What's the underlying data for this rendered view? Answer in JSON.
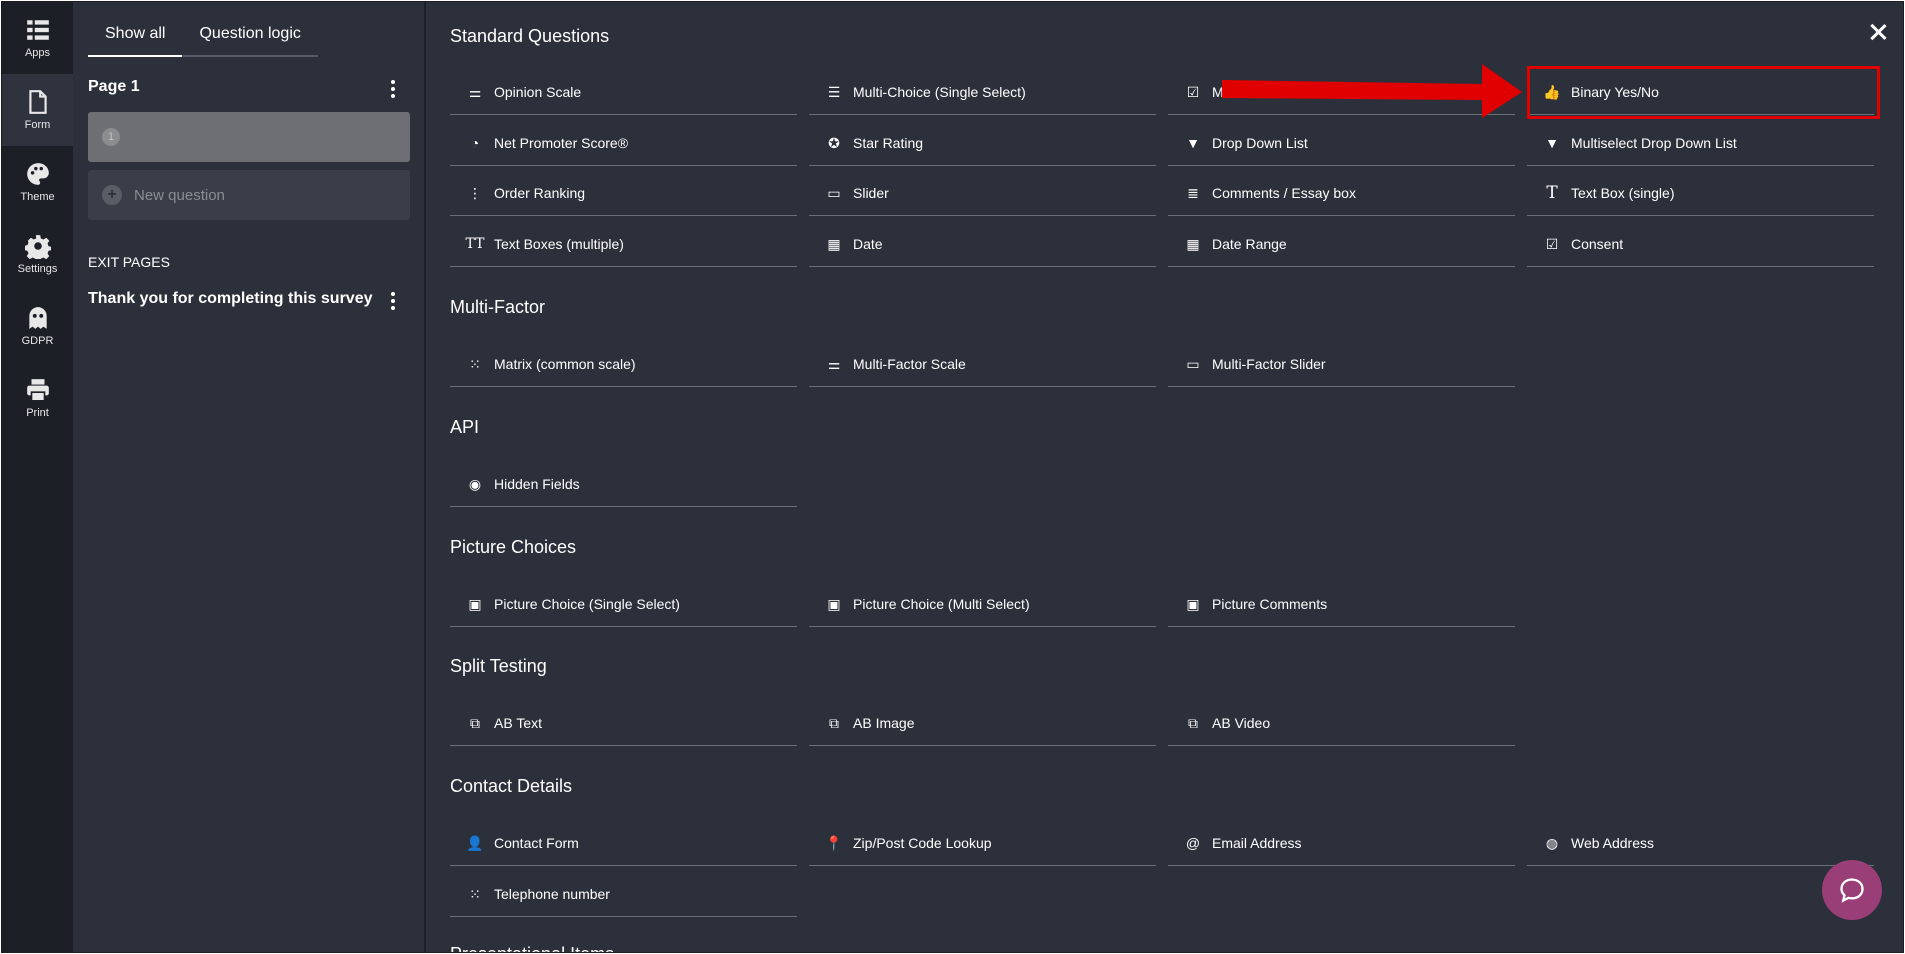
{
  "rail": [
    {
      "label": "Apps",
      "icon": "apps-grid-icon"
    },
    {
      "label": "Form",
      "icon": "document-icon"
    },
    {
      "label": "Theme",
      "icon": "palette-icon"
    },
    {
      "label": "Settings",
      "icon": "gear-icon"
    },
    {
      "label": "GDPR",
      "icon": "ghost-icon"
    },
    {
      "label": "Print",
      "icon": "printer-icon"
    }
  ],
  "panel": {
    "tabs": [
      "Show all",
      "Question logic"
    ],
    "page_title": "Page 1",
    "question_number": "1",
    "new_question": "New question",
    "exit_heading": "EXIT PAGES",
    "exit_title": "Thank you for completing this survey"
  },
  "sections": {
    "standard": {
      "title": "Standard Questions",
      "items": [
        "Opinion Scale",
        "Multi-Choice (Single Select)",
        "M",
        "Binary Yes/No",
        "Net Promoter Score®",
        "Star Rating",
        "Drop Down List",
        "Multiselect Drop Down List",
        "Order Ranking",
        "Slider",
        "Comments / Essay box",
        "Text Box (single)",
        "Text Boxes (multiple)",
        "Date",
        "Date Range",
        "Consent"
      ]
    },
    "multifactor": {
      "title": "Multi-Factor",
      "items": [
        "Matrix (common scale)",
        "Multi-Factor Scale",
        "Multi-Factor Slider"
      ]
    },
    "api": {
      "title": "API",
      "items": [
        "Hidden Fields"
      ]
    },
    "picture": {
      "title": "Picture Choices",
      "items": [
        "Picture Choice (Single Select)",
        "Picture Choice (Multi Select)",
        "Picture Comments"
      ]
    },
    "split": {
      "title": "Split Testing",
      "items": [
        "AB Text",
        "AB Image",
        "AB Video"
      ]
    },
    "contact": {
      "title": "Contact Details",
      "items": [
        "Contact Form",
        "Zip/Post Code Lookup",
        "Email Address",
        "Web Address",
        "Telephone number"
      ]
    },
    "presentational": {
      "title": "Presentational Items"
    }
  },
  "colors": {
    "background": "#2c303a",
    "rail": "#1c1f26",
    "highlight": "#e10000",
    "chat": "#9a3e78"
  }
}
